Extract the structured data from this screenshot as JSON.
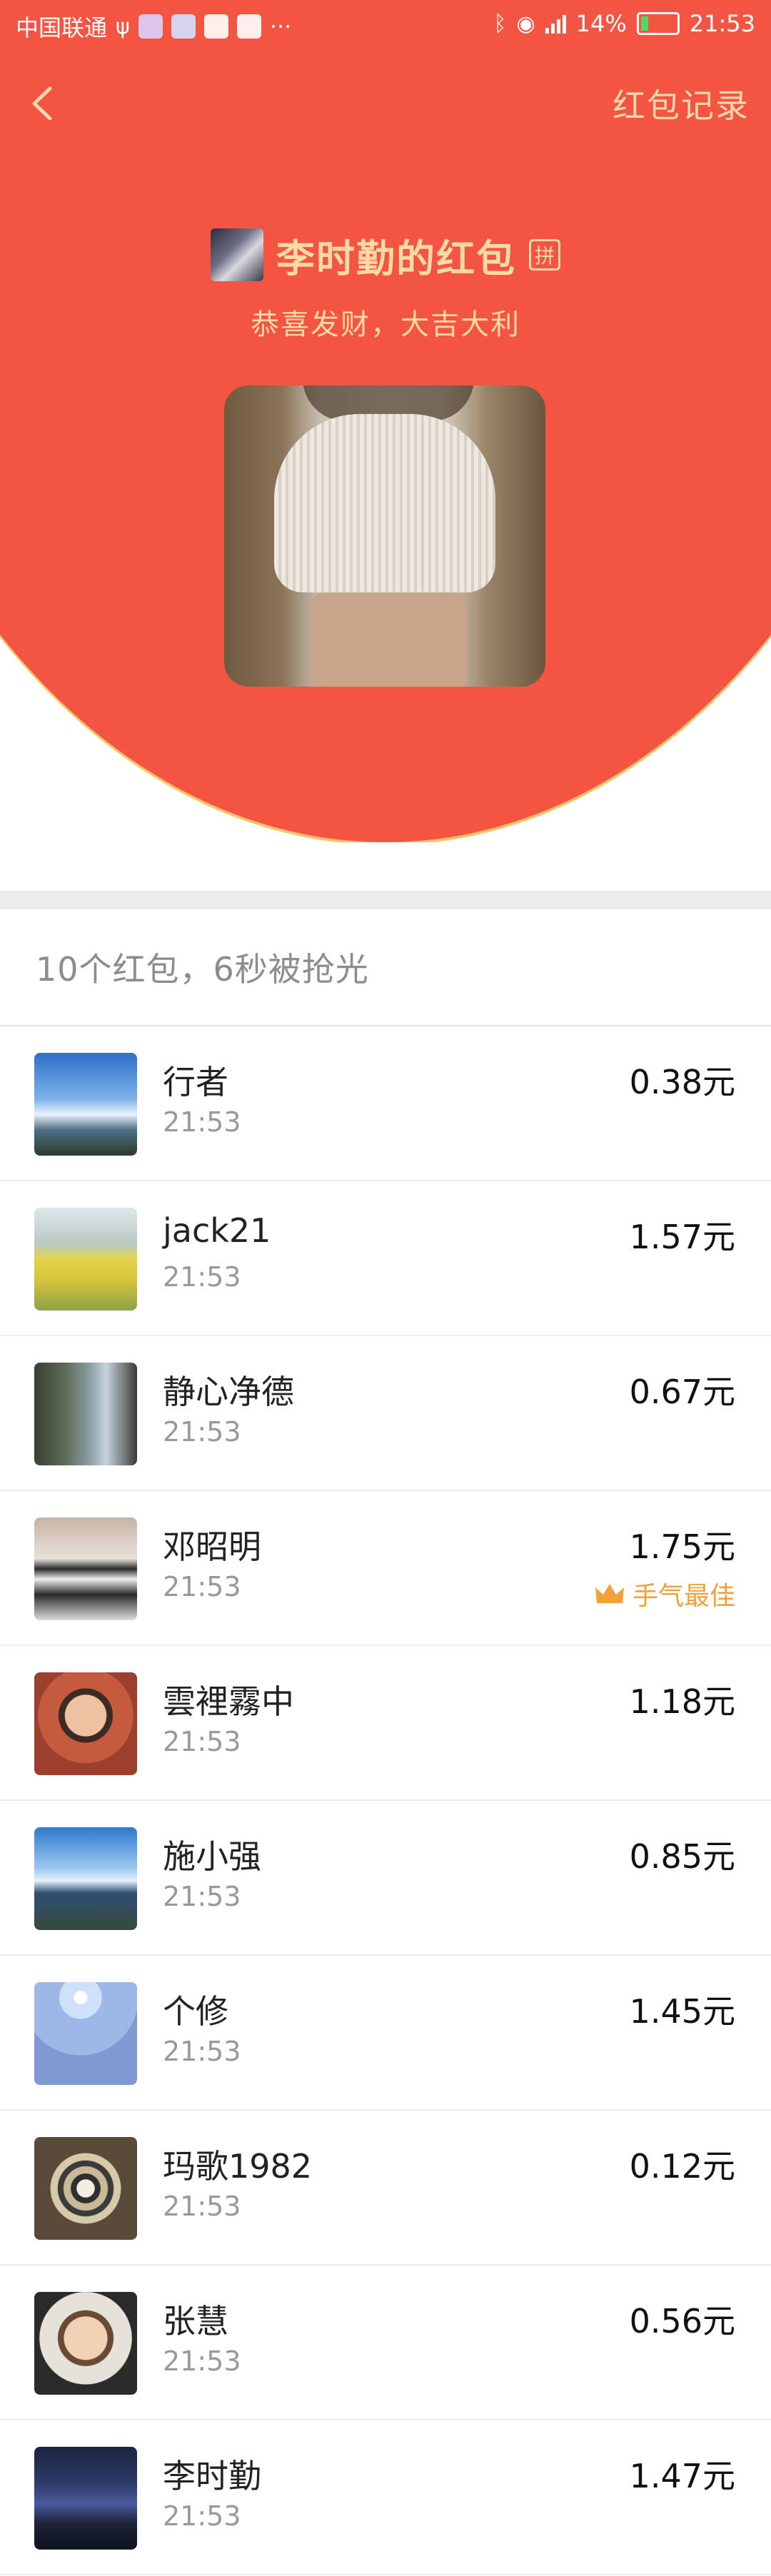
{
  "status_bar": {
    "carrier": "中国联通",
    "battery": "14%",
    "time": "21:53",
    "more": "···"
  },
  "header": {
    "records_label": "红包记录",
    "sender_name": "李时勤的红包",
    "pin_badge": "拼",
    "wish": "恭喜发财，大吉大利",
    "accent_color": "#f35542",
    "gold_color": "#ffd9a6"
  },
  "summary": "10个红包，6秒被抢光",
  "recipients": [
    {
      "name": "行者",
      "time": "21:53",
      "amount": "0.38元"
    },
    {
      "name": "jack21",
      "time": "21:53",
      "amount": "1.57元"
    },
    {
      "name": "静心净德",
      "time": "21:53",
      "amount": "0.67元"
    },
    {
      "name": "邓昭明",
      "time": "21:53",
      "amount": "1.75元",
      "badge": "手气最佳"
    },
    {
      "name": "雲裡霧中",
      "time": "21:53",
      "amount": "1.18元"
    },
    {
      "name": "施小强",
      "time": "21:53",
      "amount": "0.85元"
    },
    {
      "name": "个修",
      "time": "21:53",
      "amount": "1.45元"
    },
    {
      "name": "玛歌1982",
      "time": "21:53",
      "amount": "0.12元"
    },
    {
      "name": "张慧",
      "time": "21:53",
      "amount": "0.56元"
    },
    {
      "name": "李时勤",
      "time": "21:53",
      "amount": "1.47元"
    }
  ]
}
